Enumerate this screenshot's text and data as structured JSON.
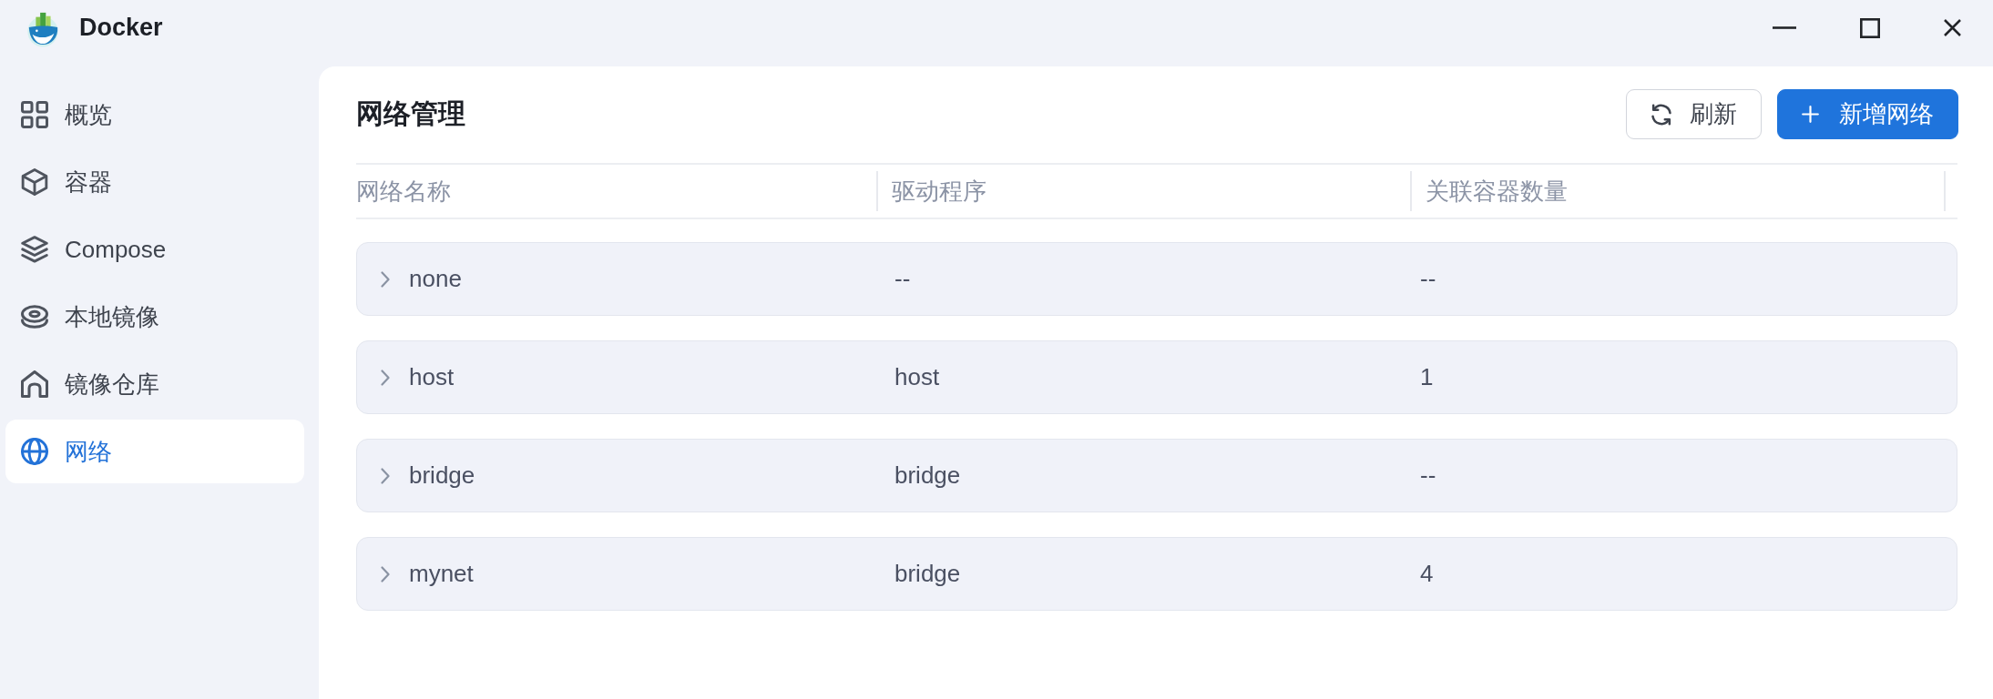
{
  "window": {
    "title": "Docker"
  },
  "sidebar": {
    "items": [
      {
        "label": "概览",
        "selected": false
      },
      {
        "label": "容器",
        "selected": false
      },
      {
        "label": "Compose",
        "selected": false
      },
      {
        "label": "本地镜像",
        "selected": false
      },
      {
        "label": "镜像仓库",
        "selected": false
      },
      {
        "label": "网络",
        "selected": true
      }
    ]
  },
  "main": {
    "title": "网络管理",
    "buttons": [
      {
        "label": "刷新",
        "kind": "secondary"
      },
      {
        "label": "新增网络",
        "kind": "primary"
      }
    ]
  },
  "table": {
    "columns": [
      "网络名称",
      "驱动程序",
      "关联容器数量"
    ],
    "rows": [
      {
        "cells": [
          "none",
          "--",
          "--"
        ],
        "expanded": false
      },
      {
        "cells": [
          "host",
          "host",
          "1"
        ],
        "expanded": false
      },
      {
        "cells": [
          "bridge",
          "bridge",
          "--"
        ],
        "expanded": false
      },
      {
        "cells": [
          "mynet",
          "bridge",
          "4"
        ],
        "expanded": false
      }
    ]
  }
}
